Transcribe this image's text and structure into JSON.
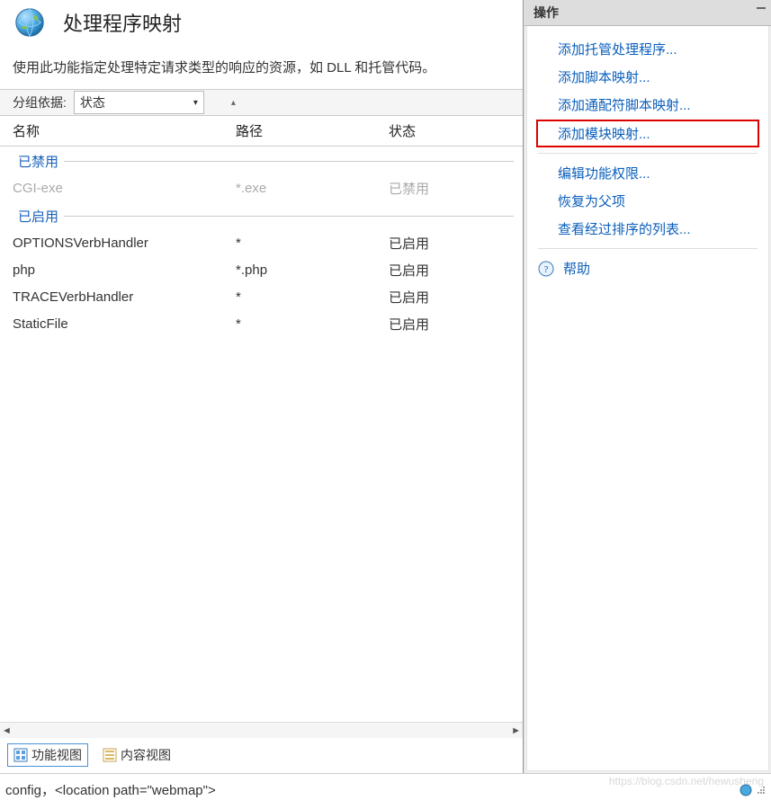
{
  "title": "处理程序映射",
  "description": "使用此功能指定处理特定请求类型的响应的资源，如 DLL 和托管代码。",
  "group_by_label": "分组依据:",
  "group_by_value": "状态",
  "columns": {
    "name": "名称",
    "path": "路径",
    "state": "状态"
  },
  "groups": [
    {
      "label": "已禁用",
      "rows": [
        {
          "name": "CGI-exe",
          "path": "*.exe",
          "state": "已禁用",
          "disabled": true
        }
      ]
    },
    {
      "label": "已启用",
      "rows": [
        {
          "name": "OPTIONSVerbHandler",
          "path": "*",
          "state": "已启用"
        },
        {
          "name": "php",
          "path": "*.php",
          "state": "已启用"
        },
        {
          "name": "TRACEVerbHandler",
          "path": "*",
          "state": "已启用"
        },
        {
          "name": "StaticFile",
          "path": "*",
          "state": "已启用"
        }
      ]
    }
  ],
  "view_tabs": {
    "features": "功能视图",
    "content": "内容视图"
  },
  "status_text": "config，<location path=\"webmap\">",
  "side": {
    "header": "操作",
    "links": {
      "add_managed": "添加托管处理程序...",
      "add_script": "添加脚本映射...",
      "add_wildcard": "添加通配符脚本映射...",
      "add_module": "添加模块映射...",
      "edit_perms": "编辑功能权限...",
      "revert_parent": "恢复为父项",
      "view_ordered": "查看经过排序的列表...",
      "help": "帮助"
    }
  },
  "watermark": "https://blog.csdn.net/hewusheng"
}
